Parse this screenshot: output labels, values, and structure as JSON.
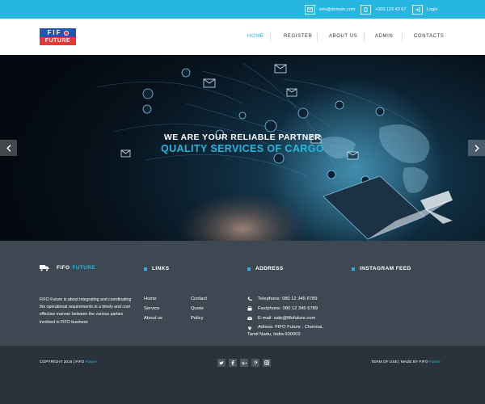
{
  "topbar": {
    "email": "info@domain.com",
    "phone": "+000 123 43 67",
    "login": "Login"
  },
  "logo": {
    "top": "FIF",
    "bottom": "FUTURE"
  },
  "nav": {
    "items": [
      "HOME",
      "REGISTER",
      "ABOUT US",
      "ADMIN",
      "CONTACTS"
    ],
    "active": "HOME"
  },
  "hero": {
    "headline": "WE ARE YOUR RELIABLE PARTNER",
    "subheadline": "QUALITY SERVICES OF CARGO",
    "prev_icon": "chevron-left-icon",
    "next_icon": "chevron-right-icon"
  },
  "footer": {
    "brand_white": "FIFO",
    "brand_blue": "FUTURE",
    "about": "FIFO Future is about integrating and coordinating the operational requirements in a timely and cost effective manner between the various parties involved in FIFO business",
    "links_heading": "LINKS",
    "links_col1": [
      "Home",
      "Service",
      "About us"
    ],
    "links_col2": [
      "Contact",
      "Quote",
      "Policy"
    ],
    "address_heading": "ADDRESS",
    "telephone": "Telephone: 080 12 345 6789",
    "fax": "Fax/phone: 080 12 345 6789",
    "email": "E-mail: sale@fifofuture.com",
    "address_line1": "Adress: FIFO Future . Chennai,",
    "address_line2": "Tamil Nadu, India 600002",
    "instagram_heading": "INSTAGRAM FEED"
  },
  "bottom": {
    "copyright_prefix": "COPYRIGHT 2016 | FIFO",
    "copyright_hl": "Future",
    "terms_prefix": "TERM OF USE | MADE BY FIFO",
    "terms_hl": "Future",
    "socials": [
      "twitter-icon",
      "facebook-icon",
      "google-plus-icon",
      "pinterest-icon",
      "instagram-icon"
    ]
  },
  "colors": {
    "accent": "#27b6df",
    "footer_bg": "#3e4852",
    "bottom_bg": "#2a323b",
    "logo_blue": "#1f56b0",
    "logo_red": "#e53935"
  }
}
